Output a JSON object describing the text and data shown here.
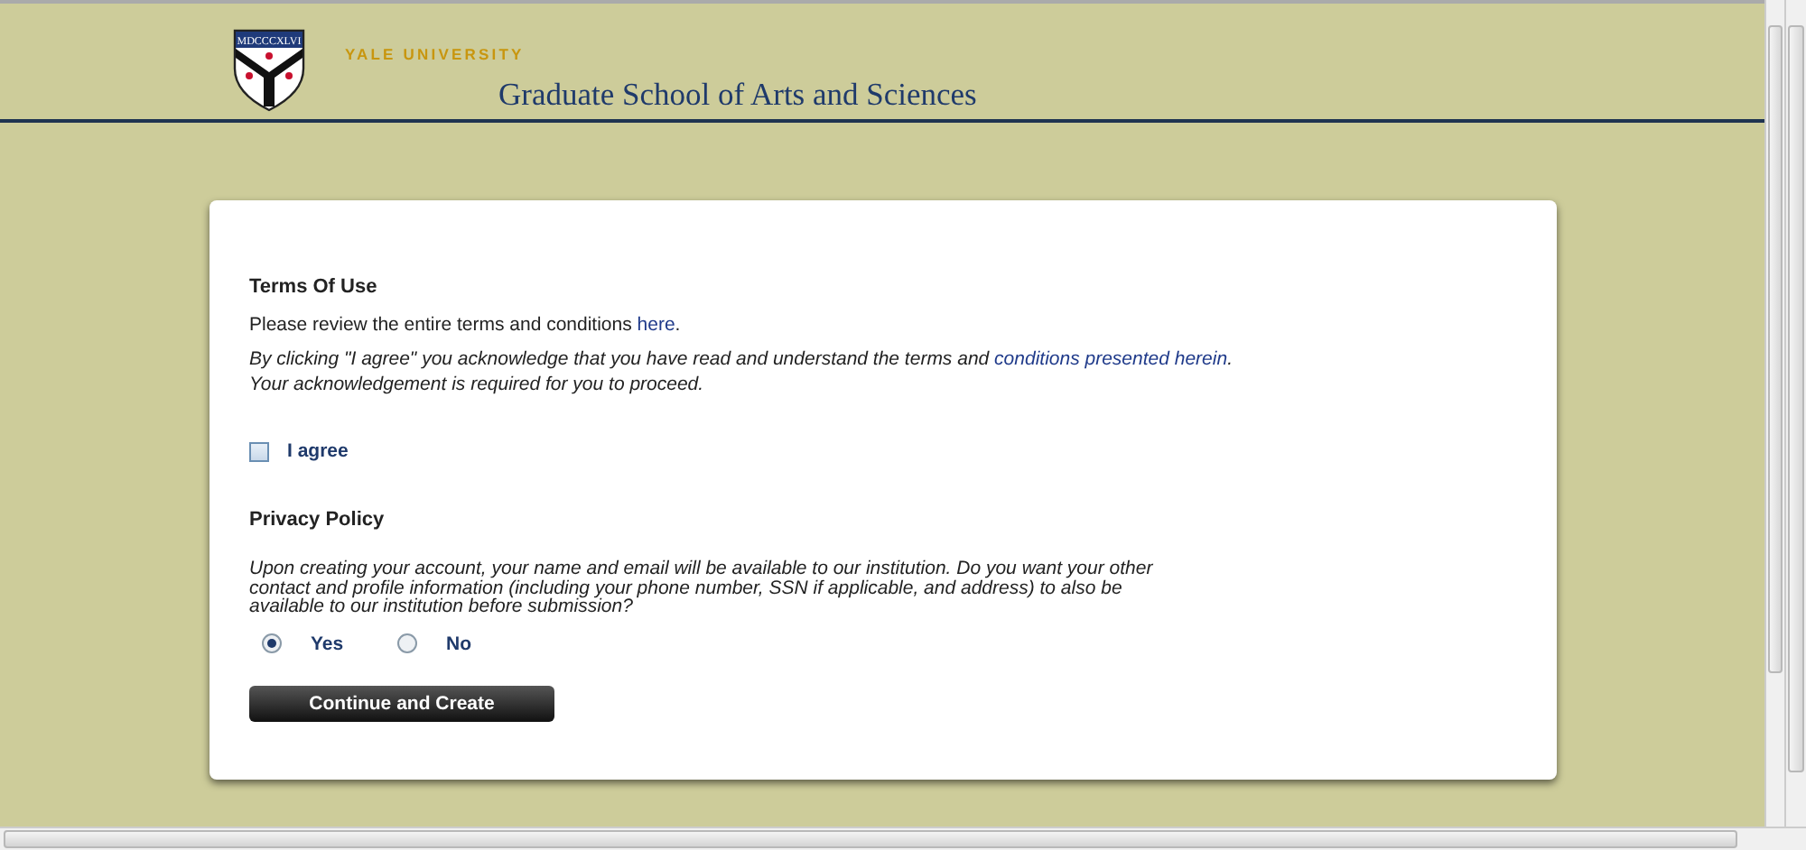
{
  "header": {
    "shield_motto": "MDCCCXLVI",
    "university": "YALE UNIVERSITY",
    "school": "Graduate School of Arts and Sciences"
  },
  "terms": {
    "title": "Terms Of Use",
    "review_text": "Please review the entire terms and conditions ",
    "review_link": "here",
    "review_end": ".",
    "ack_text": "By clicking \"I agree\" you acknowledge that you have read and understand the terms and ",
    "ack_link": "conditions presented herein",
    "ack_end": ".",
    "ack_note": "Your acknowledgement is required for you to proceed.",
    "agree": {
      "label": "I agree",
      "checked": false
    }
  },
  "privacy": {
    "title": "Privacy Policy",
    "text": "Upon creating your account, your name and email will be available to our institution. Do you want your other contact and profile information (including your phone number, SSN if applicable, and address) to also be available to our institution before submission?",
    "options": [
      {
        "label": "Yes",
        "selected": true
      },
      {
        "label": "No",
        "selected": false
      }
    ]
  },
  "button": "Continue and Create"
}
